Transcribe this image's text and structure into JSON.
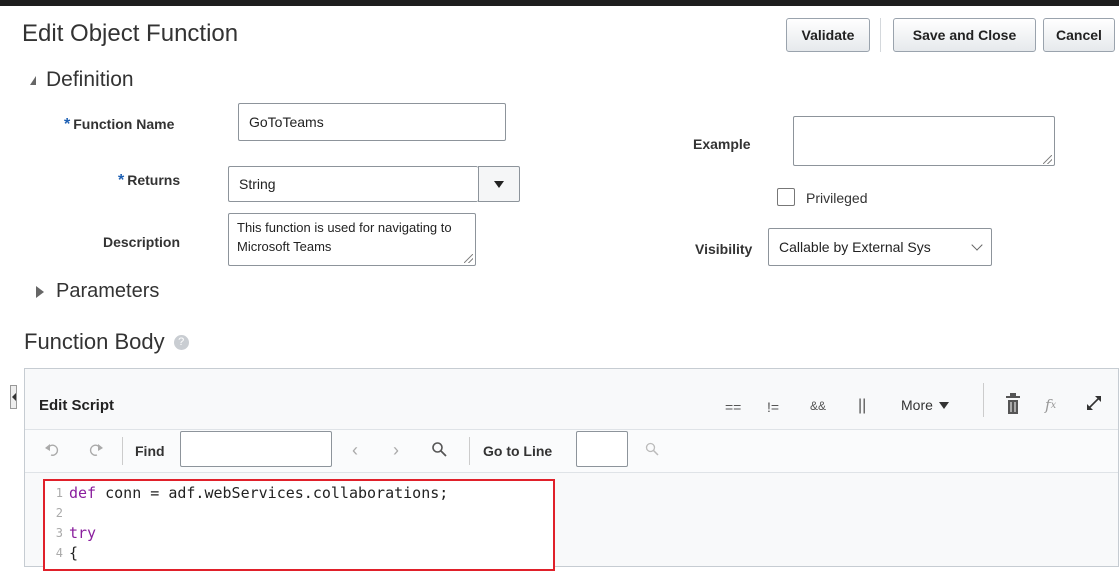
{
  "header": {
    "title": "Edit Object Function",
    "validate_label": "Validate",
    "save_close_label": "Save and Close",
    "cancel_label": "Cancel"
  },
  "definition": {
    "section_label": "Definition",
    "function_name_label": "Function Name",
    "function_name_value": "GoToTeams",
    "returns_label": "Returns",
    "returns_value": "String",
    "description_label": "Description",
    "description_value": "This function is used for navigating to Microsoft Teams",
    "example_label": "Example",
    "example_value": "",
    "privileged_label": "Privileged",
    "privileged_checked": false,
    "visibility_label": "Visibility",
    "visibility_value": "Callable by External Sys"
  },
  "parameters": {
    "section_label": "Parameters"
  },
  "function_body": {
    "title": "Function Body",
    "help_glyph": "?"
  },
  "editor": {
    "title": "Edit Script",
    "toolbar": {
      "op_equal": "==",
      "op_not_equal": "!=",
      "op_and": "&&",
      "op_or": "||",
      "more_label": "More"
    },
    "find_label": "Find",
    "find_value": "",
    "goto_label": "Go to Line",
    "goto_value": "",
    "code_lines": [
      {
        "num": "1",
        "text": "def conn = adf.webServices.collaborations;"
      },
      {
        "num": "2",
        "text": ""
      },
      {
        "num": "3",
        "text": "try"
      },
      {
        "num": "4",
        "text": "{"
      }
    ]
  },
  "icons": {
    "undo": "undo-icon",
    "redo": "redo-icon",
    "search": "search-icon",
    "delete": "trash-icon",
    "function": "function-fx-icon",
    "expand": "expand-icon"
  },
  "colors": {
    "required_asterisk": "#1d5fb3",
    "highlight_border": "#e0202a",
    "keyword": "#8a1f9e"
  }
}
